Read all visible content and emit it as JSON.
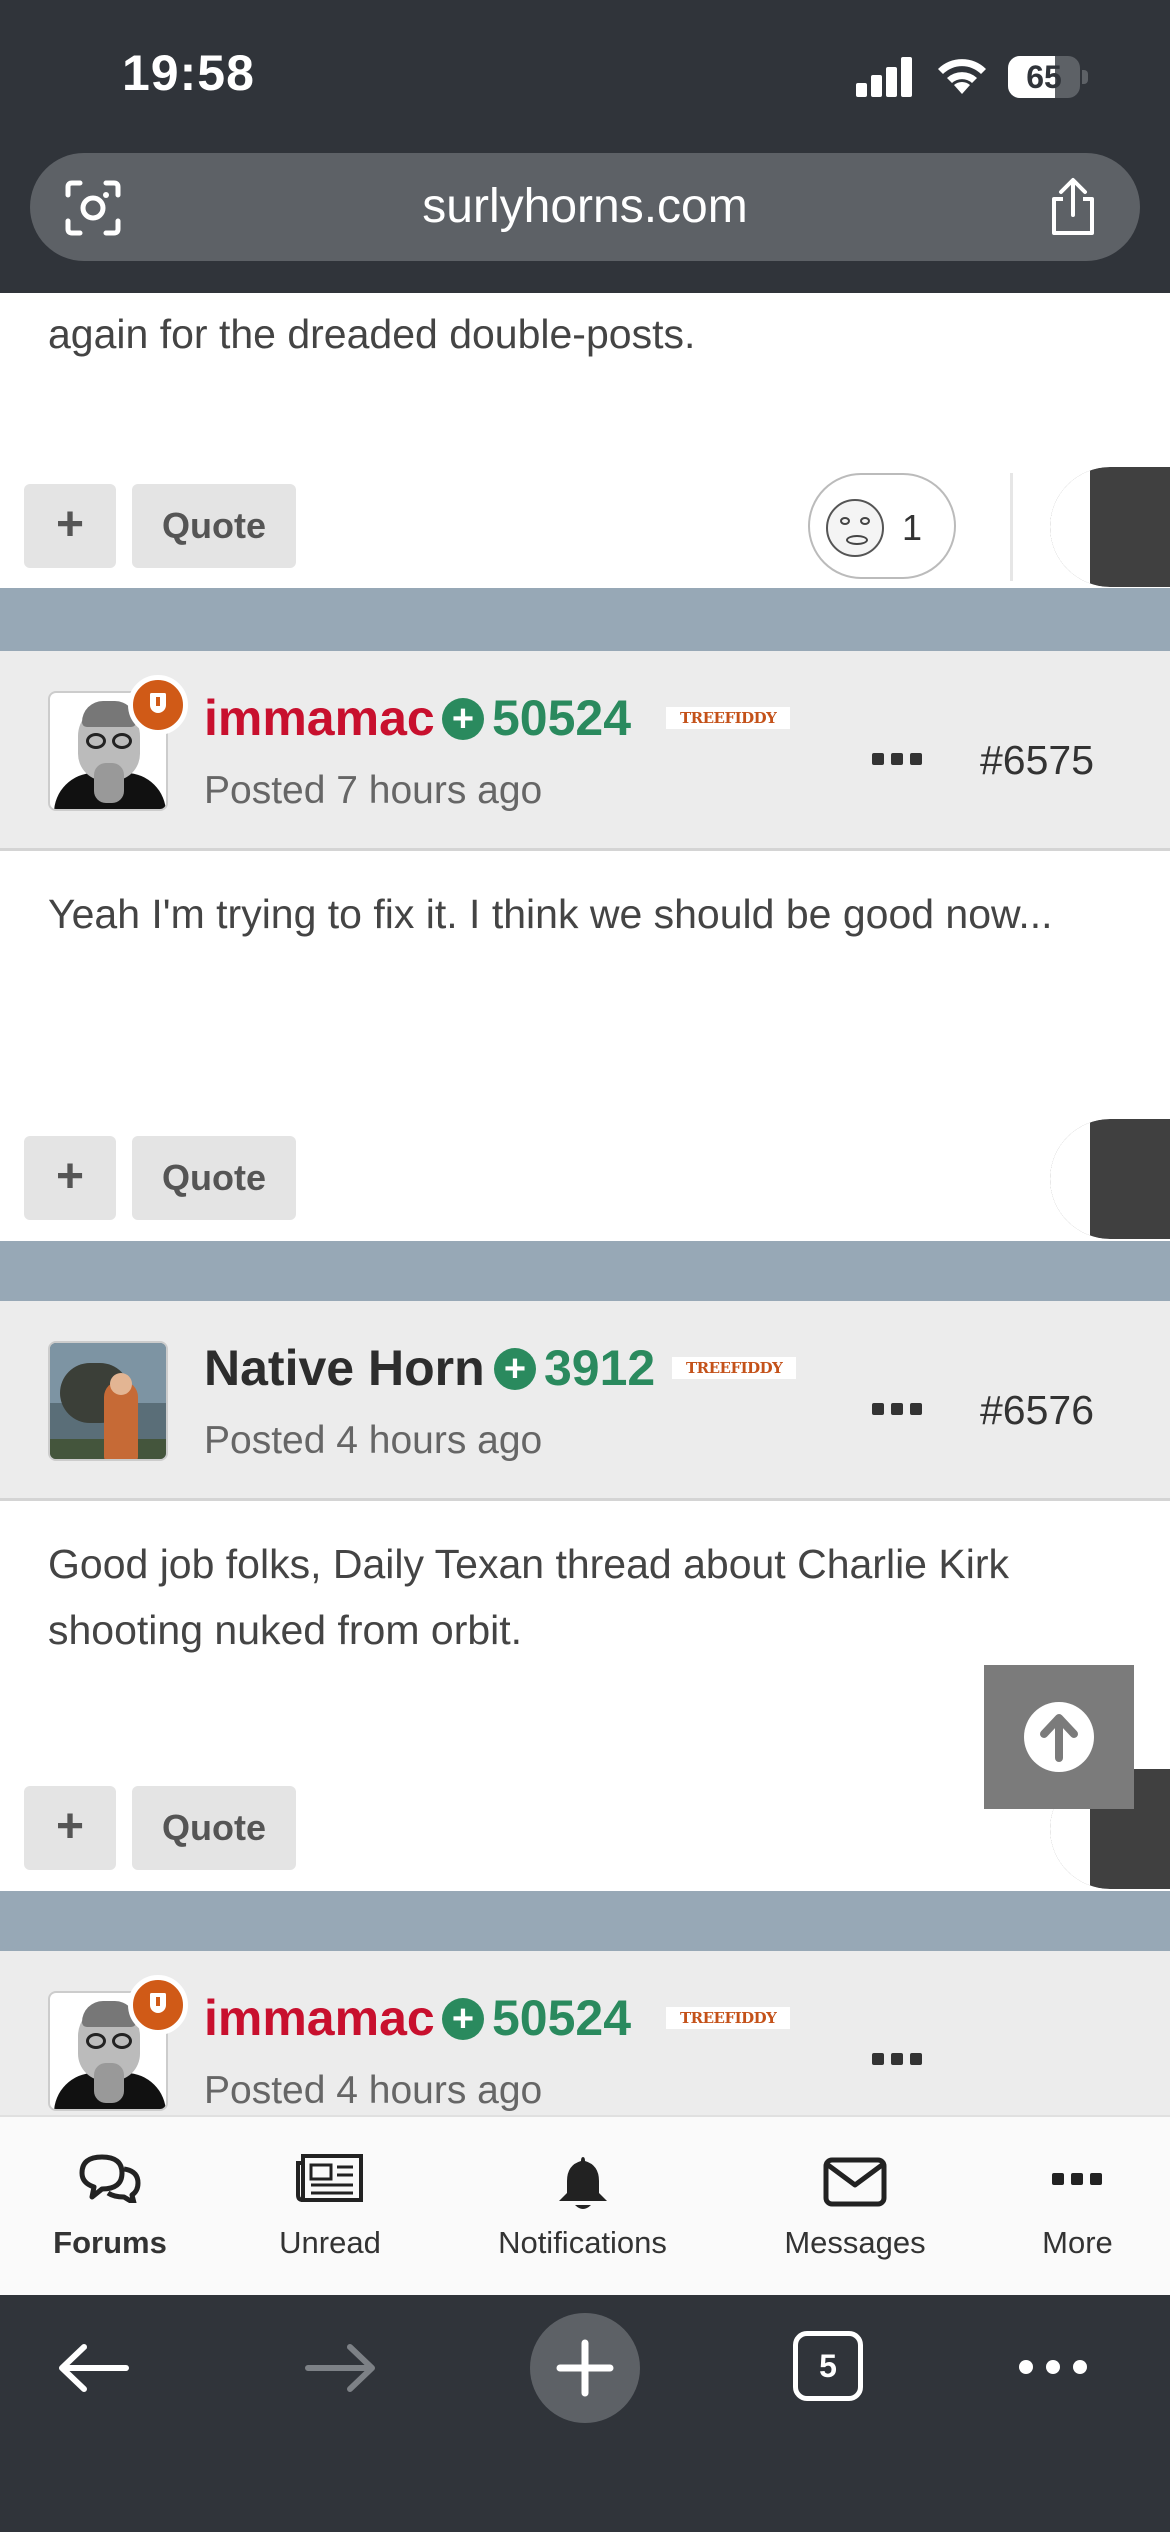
{
  "status_bar": {
    "time": "19:58",
    "battery": 65
  },
  "browser": {
    "url": "surlyhorns.com",
    "tab_count": "5"
  },
  "posts": [
    {
      "body": "again for the dreaded double-posts.",
      "plus_label": "+",
      "quote_label": "Quote",
      "reaction_count": "1"
    },
    {
      "username": "immamac",
      "reputation": "50524",
      "user_tag": "TREEFIDDY",
      "posted": "Posted 7 hours ago",
      "post_number": "#6575",
      "body": "Yeah I'm trying to fix it. I think we should be good now...",
      "plus_label": "+",
      "quote_label": "Quote"
    },
    {
      "username": "Native Horn",
      "reputation": "3912",
      "user_tag": "TREEFIDDY",
      "posted": "Posted 4 hours ago",
      "post_number": "#6576",
      "body": "Good job folks, Daily Texan thread about Charlie Kirk shooting nuked from orbit.",
      "plus_label": "+",
      "quote_label": "Quote"
    },
    {
      "username": "immamac",
      "reputation": "50524",
      "user_tag": "TREEFIDDY",
      "posted": "Posted 4 hours ago"
    }
  ],
  "tabbar": {
    "forums": "Forums",
    "unread": "Unread",
    "notifications": "Notifications",
    "messages": "Messages",
    "more": "More"
  },
  "colors": {
    "username_mod": "#c8102e",
    "reputation": "#2a8a5e",
    "header_bg": "#ececec",
    "separator": "#97a8b6",
    "chrome": "#30343a"
  }
}
